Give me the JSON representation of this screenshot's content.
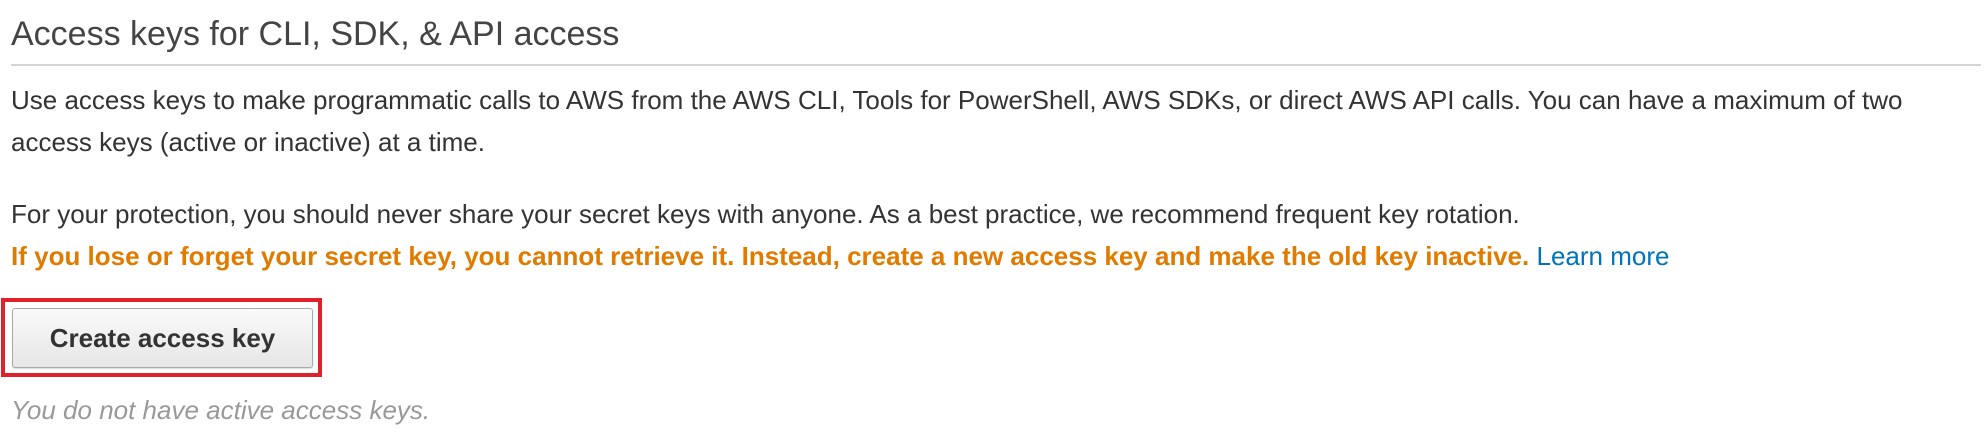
{
  "section": {
    "title": "Access keys for CLI, SDK, & API access",
    "intro": "Use access keys to make programmatic calls to AWS from the AWS CLI, Tools for PowerShell, AWS SDKs, or direct AWS API calls. You can have a maximum of two access keys (active or inactive) at a time.",
    "protection": "For your protection, you should never share your secret keys with anyone. As a best practice, we recommend frequent key rotation.",
    "warning": "If you lose or forget your secret key, you cannot retrieve it. Instead, create a new access key and make the old key inactive.",
    "learn_more": "Learn more"
  },
  "actions": {
    "create_label": "Create access key"
  },
  "status": {
    "empty_message": "You do not have active access keys."
  },
  "colors": {
    "warning": "#e07b00",
    "link": "#0073bb",
    "highlight": "#e0202a"
  }
}
